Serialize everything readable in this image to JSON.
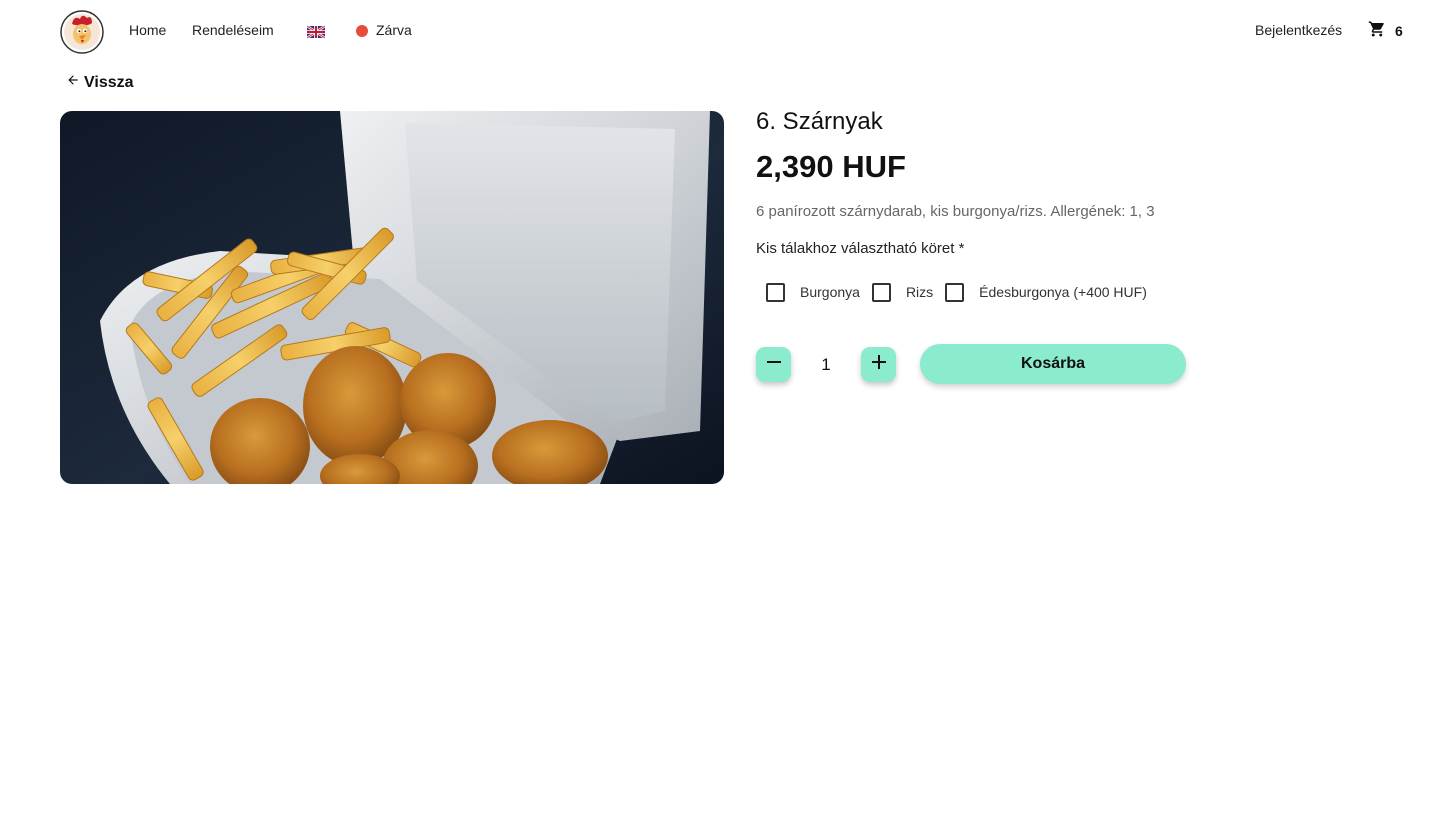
{
  "nav": {
    "links": [
      {
        "label": "Home"
      },
      {
        "label": "Rendeléseim"
      }
    ],
    "language_icon": "uk-flag-icon",
    "status": {
      "label": "Zárva",
      "color": "#e84c3d"
    },
    "login_label": "Bejelentkezés",
    "cart": {
      "icon": "shopping-cart-icon",
      "count": "6"
    }
  },
  "back": {
    "label": "Vissza",
    "icon": "arrow-left-icon"
  },
  "product": {
    "title": "6. Szárnyak",
    "price": "2,390 HUF",
    "description": "6 panírozott szárnydarab, kis burgonya/rizs. Allergének: 1, 3",
    "options_label": "Kis tálakhoz választható köret *",
    "options": [
      {
        "label": "Burgonya",
        "checked": false
      },
      {
        "label": "Rizs",
        "checked": false
      },
      {
        "label": "Édesburgonya (+400 HUF)",
        "checked": false
      }
    ],
    "quantity": "1",
    "add_to_cart_label": "Kosárba"
  },
  "colors": {
    "accent": "#8aebcf",
    "status_closed": "#e84c3d"
  }
}
